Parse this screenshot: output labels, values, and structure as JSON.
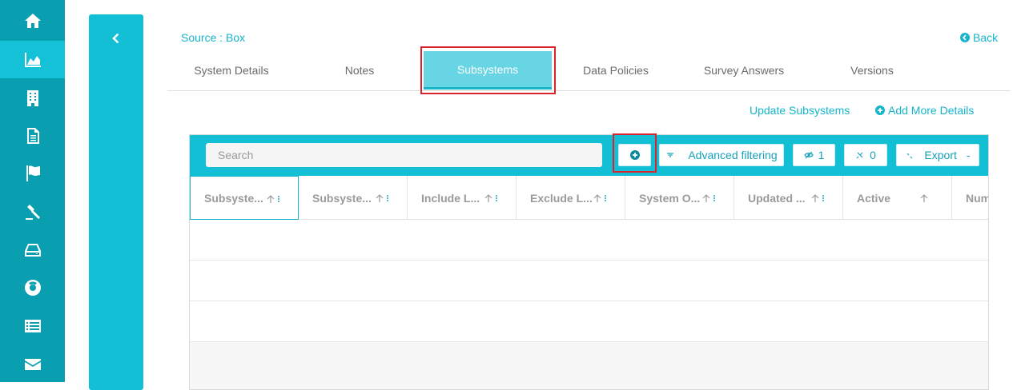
{
  "sidebar": {
    "items": [
      {
        "icon": "home-icon"
      },
      {
        "icon": "area-chart-icon",
        "active": true
      },
      {
        "icon": "building-icon"
      },
      {
        "icon": "document-icon"
      },
      {
        "icon": "flag-icon"
      },
      {
        "icon": "gavel-icon"
      },
      {
        "icon": "hard-drive-icon"
      },
      {
        "icon": "lifebuoy-icon"
      },
      {
        "icon": "list-icon"
      },
      {
        "icon": "envelope-icon"
      }
    ]
  },
  "header": {
    "source": "Source : Box",
    "back": "Back"
  },
  "tabs": [
    {
      "label": "System Details"
    },
    {
      "label": "Notes"
    },
    {
      "label": "Subsystems",
      "active": true
    },
    {
      "label": "Data Policies"
    },
    {
      "label": "Survey Answers"
    },
    {
      "label": "Versions"
    }
  ],
  "actions": {
    "update": "Update Subsystems",
    "add_more": "Add More Details"
  },
  "toolbar": {
    "search_placeholder": "Search",
    "advanced_filtering": "Advanced filtering",
    "hidden_count": "1",
    "pinned_count": "0",
    "export": "Export"
  },
  "table": {
    "columns": [
      "Subsyste...",
      "Subsyste...",
      "Include L...",
      "Exclude L...",
      "System O...",
      "Updated ...",
      "Active",
      "Num"
    ]
  },
  "colors": {
    "sidebar": "#0a9fb0",
    "accent": "#13bfd4",
    "highlight": "#d9232e"
  }
}
